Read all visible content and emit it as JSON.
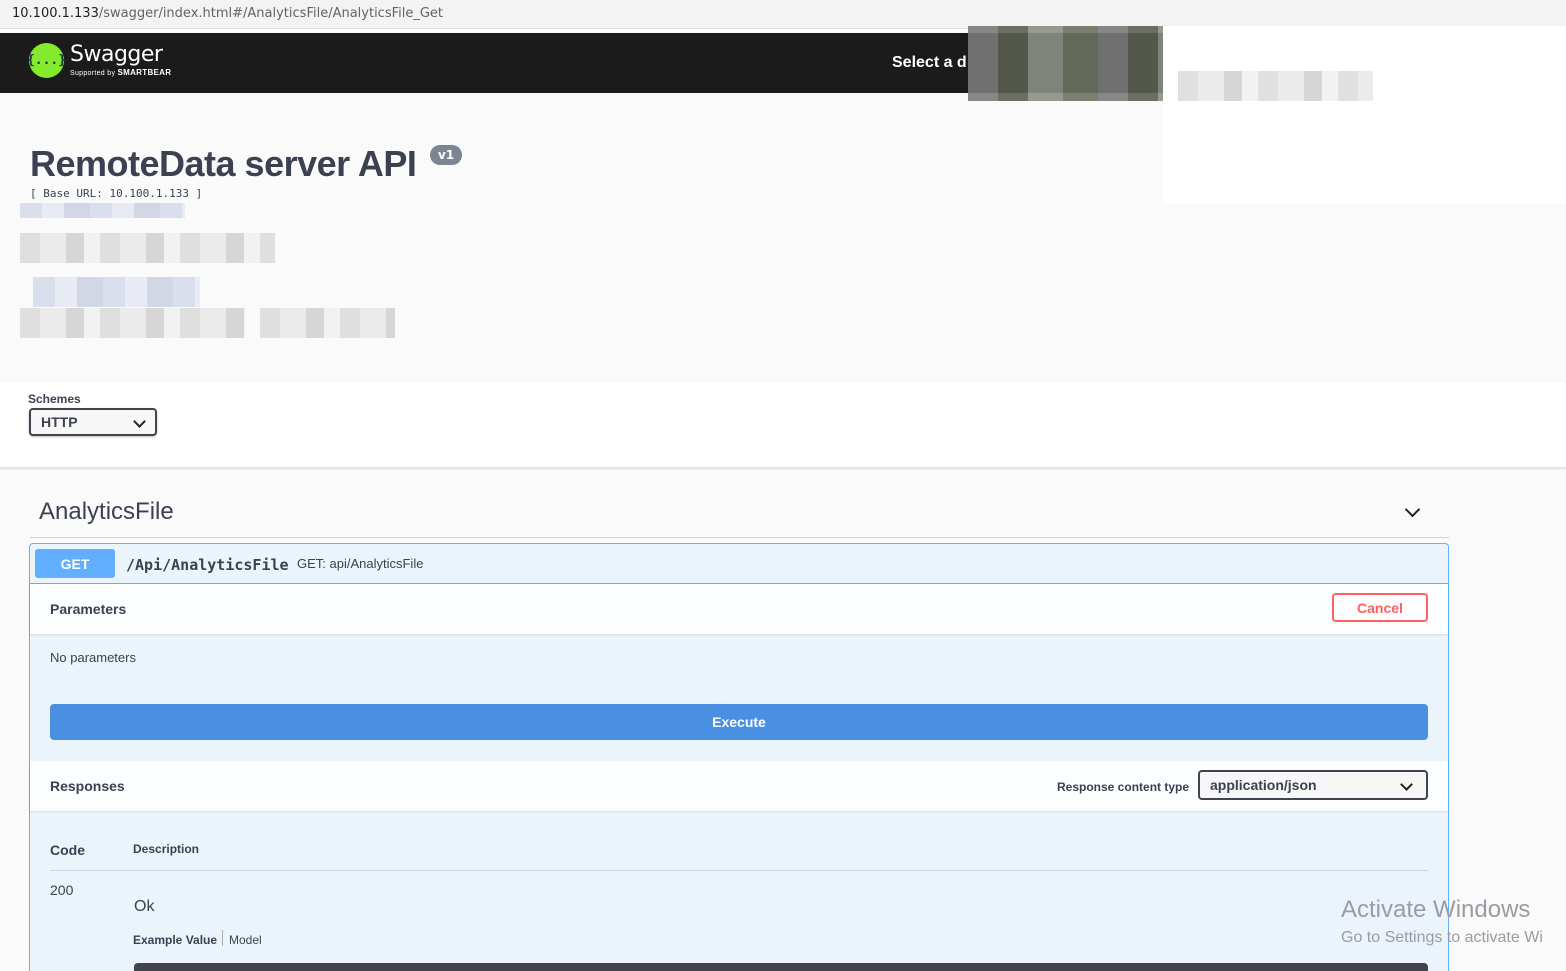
{
  "browser": {
    "url_host": "10.100.1.133",
    "url_path": "/swagger/index.html#/AnalyticsFile/AnalyticsFile_Get"
  },
  "topbar": {
    "logo_name": "Swagger",
    "logo_supported": "Supported by",
    "logo_brand": "SMARTBEAR",
    "logo_glyph": "{...}",
    "select_definition": "Select a d"
  },
  "info": {
    "title": "RemoteData server API",
    "version": "v1",
    "base_url": "[ Base URL: 10.100.1.133 ]"
  },
  "schemes": {
    "label": "Schemes",
    "selected": "HTTP"
  },
  "tag": {
    "name": "AnalyticsFile"
  },
  "operation": {
    "method": "GET",
    "path": "/Api/AnalyticsFile",
    "summary": "GET: api/AnalyticsFile",
    "parameters_label": "Parameters",
    "cancel_label": "Cancel",
    "no_parameters": "No parameters",
    "execute_label": "Execute",
    "responses_label": "Responses",
    "response_content_type_label": "Response content type",
    "response_content_type": "application/json",
    "code_header": "Code",
    "description_header": "Description",
    "responses": [
      {
        "code": "200",
        "description": "Ok"
      }
    ],
    "example_value_tab": "Example Value",
    "model_tab": "Model"
  },
  "watermark": {
    "line1": "Activate Windows",
    "line2": "Go to Settings to activate Wi"
  },
  "colors": {
    "get_method": "#61affe",
    "execute": "#4990e2",
    "cancel": "#ff6060",
    "topbar": "#1b1b1b",
    "logo_green": "#85ea2d"
  }
}
